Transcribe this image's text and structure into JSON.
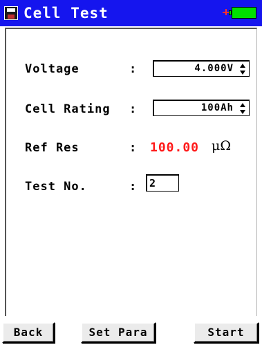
{
  "title": "Cell Test",
  "fields": {
    "voltage": {
      "label": "Voltage",
      "colon": ":",
      "value": "4.000V"
    },
    "cell_rating": {
      "label": "Cell Rating",
      "colon": ":",
      "value": "100Ah"
    },
    "ref_res": {
      "label": "Ref Res",
      "colon": ":",
      "value": "100.00",
      "unit": "μΩ",
      "value_color": "#ff1a1a"
    },
    "test_no": {
      "label": "Test No.",
      "colon": ":",
      "value": "2"
    }
  },
  "buttons": {
    "back": "Back",
    "set_para": "Set Para",
    "start": "Start"
  },
  "status": {
    "charging_icon": "plug-icon",
    "battery_icon": "battery-icon"
  },
  "colors": {
    "titlebar": "#1515ee",
    "battery": "#00e000"
  }
}
